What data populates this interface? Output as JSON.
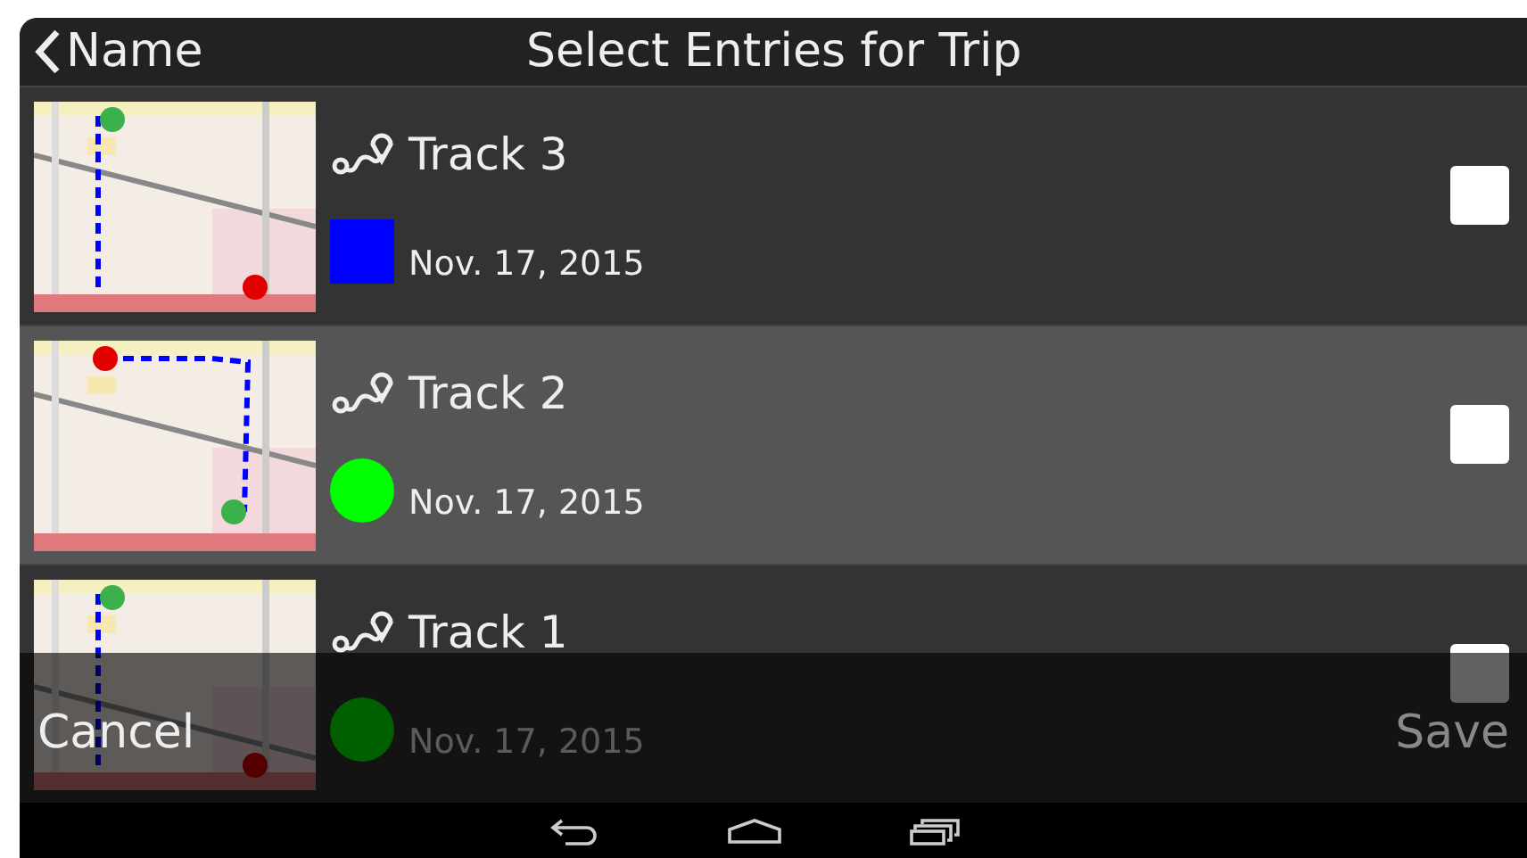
{
  "header": {
    "back_label": "Name",
    "title": "Select Entries for Trip"
  },
  "entries": [
    {
      "name": "Track 3",
      "date": "Nov. 17, 2015",
      "marker": {
        "kind": "square",
        "color": "#0000ff"
      },
      "selected": false,
      "checked": false
    },
    {
      "name": "Track 2",
      "date": "Nov. 17, 2015",
      "marker": {
        "kind": "circle",
        "color": "#00ff00"
      },
      "selected": true,
      "checked": false
    },
    {
      "name": "Track 1",
      "date": "Nov. 17, 2015",
      "marker": {
        "kind": "circle",
        "color": "#006000"
      },
      "selected": false,
      "checked": false
    }
  ],
  "action_bar": {
    "cancel": "Cancel",
    "save": {
      "label": "Save",
      "disabled": true
    }
  }
}
